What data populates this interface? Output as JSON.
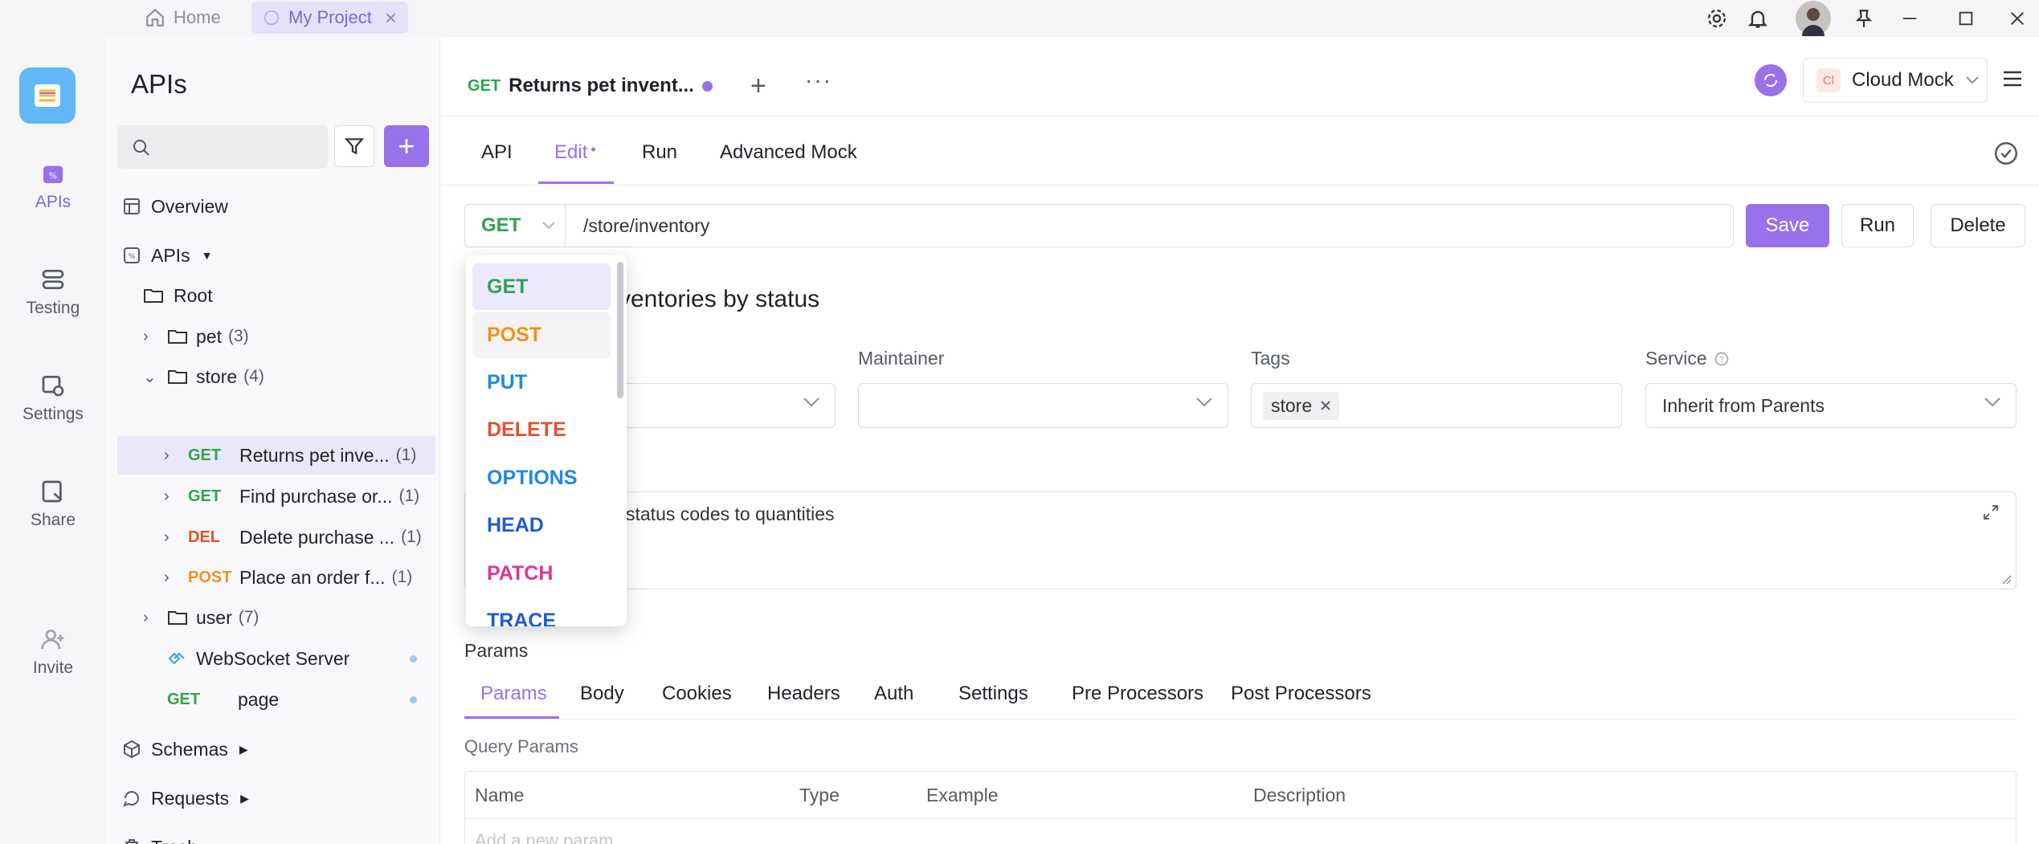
{
  "titlebar": {
    "tabs": [
      {
        "label": "Home",
        "icon": "home-icon"
      },
      {
        "label": "My Project",
        "icon": "project-icon",
        "active": true
      }
    ]
  },
  "rail": {
    "items": [
      {
        "label": "APIs",
        "icon": "apis-icon",
        "active": true
      },
      {
        "label": "Testing",
        "icon": "testing-icon"
      },
      {
        "label": "Settings",
        "icon": "settings-icon"
      },
      {
        "label": "Share",
        "icon": "share-icon"
      },
      {
        "label": "Invite",
        "icon": "invite-icon"
      }
    ]
  },
  "sidebar": {
    "title": "APIs",
    "search_placeholder": "",
    "overview": "Overview",
    "apis_label": "APIs",
    "root": "Root",
    "folders": {
      "pet": {
        "name": "pet",
        "count": "(3)"
      },
      "store": {
        "name": "store",
        "count": "(4)"
      },
      "user": {
        "name": "user",
        "count": "(7)"
      }
    },
    "store_items": [
      {
        "method": "GET",
        "name": "Returns pet inve...",
        "count": "(1)"
      },
      {
        "method": "GET",
        "name": "Find purchase or...",
        "count": "(1)"
      },
      {
        "method": "DEL",
        "name": "Delete purchase ...",
        "count": "(1)"
      },
      {
        "method": "POST",
        "name": "Place an order f...",
        "count": "(1)"
      }
    ],
    "websocket": "WebSocket Server",
    "page_item": {
      "method": "GET",
      "name": "page"
    },
    "schemas": "Schemas",
    "requests": "Requests",
    "trash": "Trash"
  },
  "header": {
    "doc_tab": {
      "method": "GET",
      "title": "Returns pet invent..."
    },
    "env": "Cloud Mock",
    "env_badge": "Cl"
  },
  "subtabs": {
    "api": "API",
    "edit": "Edit",
    "run": "Run",
    "mock": "Advanced Mock"
  },
  "request": {
    "method": "GET",
    "path": "/store/inventory",
    "save": "Save",
    "run": "Run",
    "delete": "Delete"
  },
  "doc": {
    "name_fragment": "ventories by status",
    "maintainer_label": "Maintainer",
    "tags_label": "Tags",
    "tag": "store",
    "service_label": "Service",
    "service_value": "Inherit from Parents",
    "description_fragment": "status codes to quantities"
  },
  "params": {
    "section_label": "Params",
    "tabs": [
      "Params",
      "Body",
      "Cookies",
      "Headers",
      "Auth",
      "Settings",
      "Pre Processors",
      "Post Processors"
    ],
    "query_label": "Query Params",
    "columns": [
      "Name",
      "Type",
      "Example",
      "Description"
    ],
    "add_placeholder": "Add a new param"
  },
  "method_dropdown": {
    "options": [
      {
        "label": "GET",
        "color": "#2da44e"
      },
      {
        "label": "POST",
        "color": "#f0921a"
      },
      {
        "label": "PUT",
        "color": "#1e88e5"
      },
      {
        "label": "DELETE",
        "color": "#e4502c"
      },
      {
        "label": "OPTIONS",
        "color": "#1e88e5"
      },
      {
        "label": "HEAD",
        "color": "#1e5bd6"
      },
      {
        "label": "PATCH",
        "color": "#e0348f"
      },
      {
        "label": "TRACE",
        "color": "#1e5bd6"
      }
    ]
  },
  "colors": {
    "accent": "#9772ea",
    "get": "#2da44e",
    "post": "#f0921a",
    "delete": "#e4502c"
  }
}
